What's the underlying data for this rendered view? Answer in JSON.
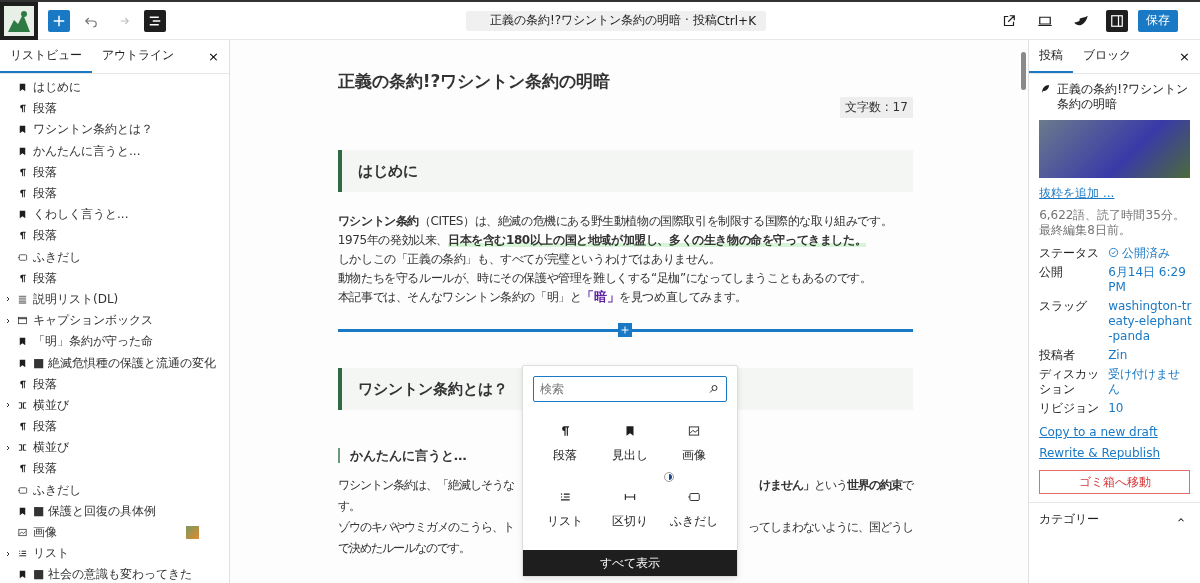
{
  "toolbar": {
    "buttons": [
      {
        "kind": "add",
        "on": true
      },
      {
        "kind": "undo",
        "disabled": false
      },
      {
        "kind": "redo",
        "disabled": true
      },
      {
        "kind": "listview",
        "on": true
      }
    ],
    "command": {
      "title": "正義の条約!?ワシントン条約の明暗 · 投稿",
      "shortcut": "Ctrl+K"
    },
    "right_buttons": [
      {
        "kind": "external"
      },
      {
        "kind": "desktop"
      },
      {
        "kind": "swell"
      },
      {
        "kind": "sidebar",
        "on": true
      }
    ],
    "save": "保存"
  },
  "list_panel": {
    "tabs": [
      {
        "label": "リストビュー",
        "selected": true
      },
      {
        "label": "アウトライン",
        "selected": false
      }
    ],
    "close": "×",
    "items": [
      {
        "kind": "heading",
        "label": "はじめに",
        "expandable": false
      },
      {
        "kind": "paragraph",
        "label": "段落",
        "expandable": false
      },
      {
        "kind": "heading",
        "label": "ワシントン条約とは？",
        "expandable": false
      },
      {
        "kind": "heading",
        "label": "かんたんに言うと...",
        "expandable": false
      },
      {
        "kind": "paragraph",
        "label": "段落",
        "expandable": false
      },
      {
        "kind": "paragraph",
        "label": "段落",
        "expandable": false
      },
      {
        "kind": "heading",
        "label": "くわしく言うと...",
        "expandable": false
      },
      {
        "kind": "paragraph",
        "label": "段落",
        "expandable": false
      },
      {
        "kind": "balloon",
        "label": "ふきだし",
        "expandable": false
      },
      {
        "kind": "paragraph",
        "label": "段落",
        "expandable": false
      },
      {
        "kind": "dl",
        "label": "説明リスト(DL)",
        "expandable": true
      },
      {
        "kind": "caption",
        "label": "キャプションボックス",
        "expandable": true
      },
      {
        "kind": "heading",
        "label": "「明」条約が守った命",
        "expandable": false
      },
      {
        "kind": "heading",
        "label": "■ 絶滅危惧種の保護と流通の変化",
        "expandable": false
      },
      {
        "kind": "paragraph",
        "label": "段落",
        "expandable": false
      },
      {
        "kind": "columns",
        "label": "横並び",
        "expandable": true
      },
      {
        "kind": "paragraph",
        "label": "段落",
        "expandable": false
      },
      {
        "kind": "columns",
        "label": "横並び",
        "expandable": true
      },
      {
        "kind": "paragraph",
        "label": "段落",
        "expandable": false
      },
      {
        "kind": "balloon",
        "label": "ふきだし",
        "expandable": false
      },
      {
        "kind": "heading",
        "label": "■ 保護と回復の具体例",
        "expandable": false
      },
      {
        "kind": "image",
        "label": "画像",
        "expandable": false,
        "thumbnail": true
      },
      {
        "kind": "list",
        "label": "リスト",
        "expandable": true
      },
      {
        "kind": "heading",
        "label": "■ 社会の意識も変わってきた",
        "expandable": false
      }
    ]
  },
  "editor": {
    "title": "正義の条約!?ワシントン条約の明暗",
    "char_count": "文字数 : 17",
    "blocks": [
      {
        "kind": "h2",
        "text": "はじめに"
      },
      {
        "kind": "lines",
        "lines": [
          [
            {
              "kind": "bold",
              "text": "ワシントン条約"
            },
            {
              "kind": "plain",
              "text": "（CITES）は、絶滅の危機にある野生動植物の国際取引を制限する国際的な取り組みです。"
            }
          ],
          [
            {
              "kind": "plain",
              "text": "1975年の発効以来、"
            },
            {
              "kind": "marker",
              "text": "日本を含む180以上の国と地域が加盟し、多くの生き物の命を守ってきました。"
            }
          ],
          [
            {
              "kind": "plain",
              "text": "しかしこの「正義の条約」も、すべてが完璧というわけではありません。"
            }
          ],
          [
            {
              "kind": "plain",
              "text": "動物たちを守るルールが、時にその保護や管理を難しくする“足枷”になってしまうこともあるのです。"
            }
          ],
          [
            {
              "kind": "plain",
              "text": "本記事では、そんなワシントン条約の「明」と"
            },
            {
              "kind": "accent",
              "text": "「暗」"
            },
            {
              "kind": "plain",
              "text": "を見つめ直してみます。"
            }
          ]
        ]
      },
      {
        "kind": "inserter"
      },
      {
        "kind": "h2",
        "text": "ワシントン条約とは？"
      },
      {
        "kind": "h3",
        "text": "かんたんに言うと…"
      },
      {
        "kind": "split",
        "lines": [
          {
            "left": "ワシントン条約は、「絶滅しそうな",
            "right": "**けません」**という**世界の約束**で"
          },
          {
            "left": "す。"
          },
          {
            "left": "ゾウのキバやウミガメのこうら、ト",
            "right": "ってしまわないように、国どうし"
          },
          {
            "left": "で決めたルールなのです。"
          }
        ]
      }
    ]
  },
  "inserter_popover": {
    "placeholder": "検索",
    "blocks": [
      {
        "kind": "paragraph",
        "label": "段落"
      },
      {
        "kind": "heading",
        "label": "見出し"
      },
      {
        "kind": "image",
        "label": "画像"
      },
      {
        "kind": "list",
        "label": "リスト"
      },
      {
        "kind": "separator",
        "label": "区切り"
      },
      {
        "kind": "balloon",
        "label": "ふきだし"
      }
    ],
    "browse_all": "すべて表示"
  },
  "settings": {
    "tabs": [
      {
        "label": "投稿",
        "selected": true
      },
      {
        "label": "ブロック",
        "selected": false
      }
    ],
    "close": "×",
    "post_title": "正義の条約!?ワシントン条約の明暗",
    "excerpt_link": "抜粋を追加 ...",
    "stats": [
      "6,622語、読了時間35分。",
      "最終編集8日前。"
    ],
    "rows": [
      {
        "label": "ステータス",
        "value": "公開済み",
        "icon": true
      },
      {
        "label": "公開",
        "value": "6月14日 6:29 PM",
        "icon": false
      },
      {
        "label": "スラッグ",
        "value": "washington-treaty-elephant-panda",
        "icon": false
      },
      {
        "label": "投稿者",
        "value": "Zin",
        "icon": false
      },
      {
        "label": "ディスカッション",
        "value": "受け付けません",
        "icon": false
      },
      {
        "label": "リビジョン",
        "value": "10",
        "icon": false
      }
    ],
    "links": [
      "Copy to a new draft",
      "Rewrite & Republish"
    ],
    "trash": "ゴミ箱へ移動",
    "section": {
      "title": "カテゴリー",
      "expanded": true
    }
  }
}
